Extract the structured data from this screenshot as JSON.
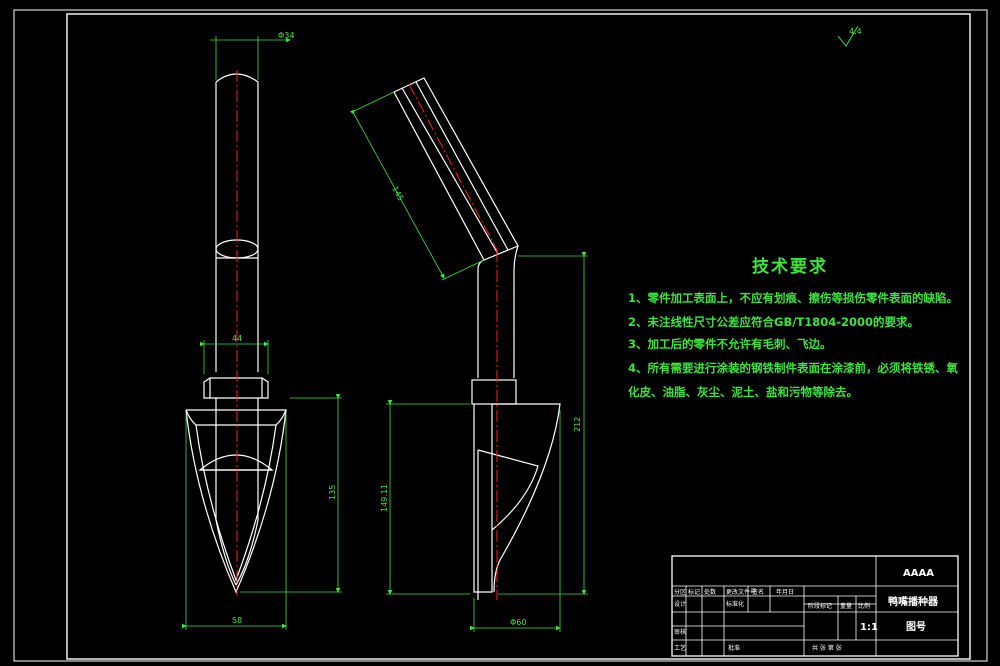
{
  "drawing": {
    "frame_color": "#ffffff",
    "dimension_color": "#3ee33e",
    "centerline_color": "#ff2020",
    "roughness": "4.4"
  },
  "dimensions": {
    "top_width": "Φ34",
    "neck_width": "44",
    "front_height": "135",
    "bottom_width": "58",
    "pipe_length": "145",
    "side_height_inner": "149.11",
    "side_height_total": "212",
    "side_bottom_width": "Φ60"
  },
  "technical_requirements": {
    "title": "技术要求",
    "items": [
      "1、零件加工表面上，不应有划痕、擦伤等损伤零件表面的缺陷。",
      "2、未注线性尺寸公差应符合GB/T1804-2000的要求。",
      "3、加工后的零件不允许有毛刺、飞边。",
      "4、所有需要进行涂装的钢铁制件表面在涂漆前，必须将铁锈、氧",
      "化皮、油脂、灰尘、泥土、盐和污物等除去。"
    ]
  },
  "title_block": {
    "company": "AAAA",
    "part_name": "鸭嘴播种器",
    "drawing_no": "图号",
    "scale": "1:1",
    "header_cells": [
      "分区",
      "标记",
      "处数",
      "更改文件号",
      "签名",
      "年月日"
    ],
    "row_design": "设计",
    "row_standard": "标准化",
    "row_review": "审核",
    "row_process": "工艺",
    "row_approve": "批准",
    "stage_mark": "阶段标记",
    "weight": "重量",
    "ratio": "比例",
    "sheets": "共 张 第 张"
  }
}
